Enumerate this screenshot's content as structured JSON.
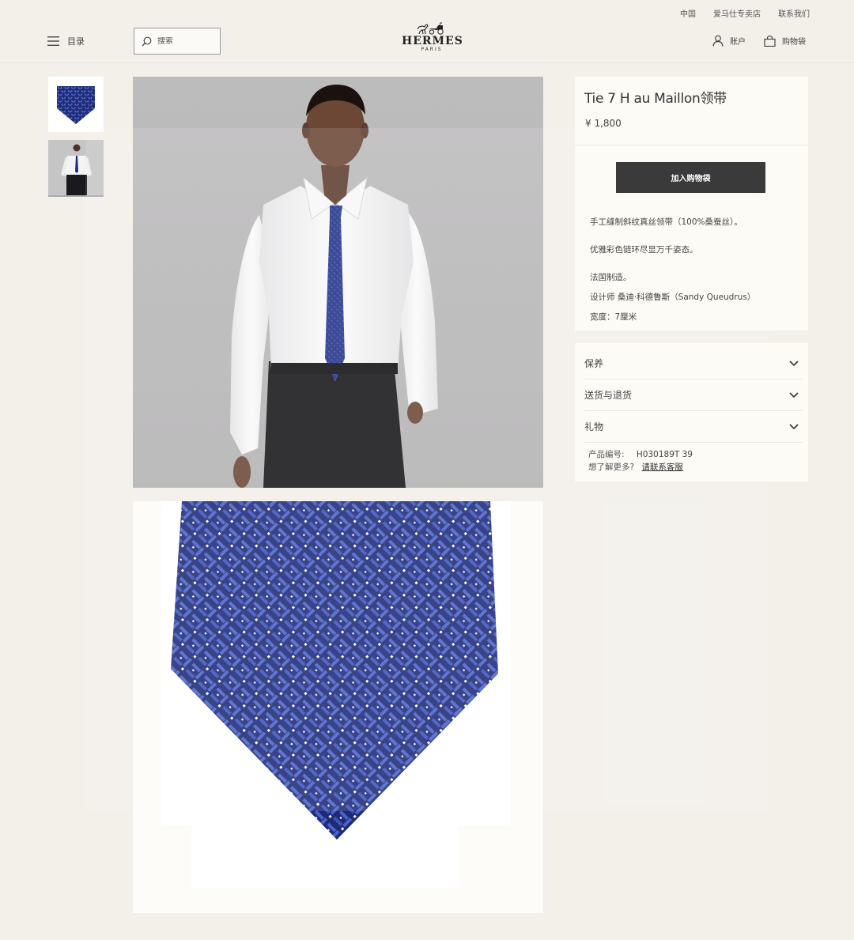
{
  "utility": {
    "region": "中国",
    "stores": "爱马仕专卖店",
    "contact": "联系我们"
  },
  "header": {
    "menu_label": "目录",
    "search_placeholder": "搜索",
    "brand": "HERMES",
    "city": "PARIS",
    "account_label": "账户",
    "bag_label": "购物袋"
  },
  "product": {
    "title": "Tie 7 H au Maillon领带",
    "price": "¥ 1,800",
    "add_to_bag": "加入购物袋",
    "description": [
      "手工缝制斜纹真丝领带（100%桑蚕丝）。",
      "优雅彩色链环尽显万千姿态。",
      "法国制造。",
      "设计师 桑迪·科德鲁斯（Sandy Queudrus）",
      "宽度：7厘米"
    ]
  },
  "accordion": {
    "items": [
      "保养",
      "送货与退货",
      "礼物"
    ],
    "product_code_label": "产品编号:",
    "product_code": "H030189T 39",
    "more_question": "想了解更多?",
    "contact_link": "请联系客服"
  },
  "colors": {
    "background": "#f3f0ea",
    "panel": "#fcfbf6",
    "button": "#3a3a3a",
    "tie_navy": "#1f2c78"
  }
}
